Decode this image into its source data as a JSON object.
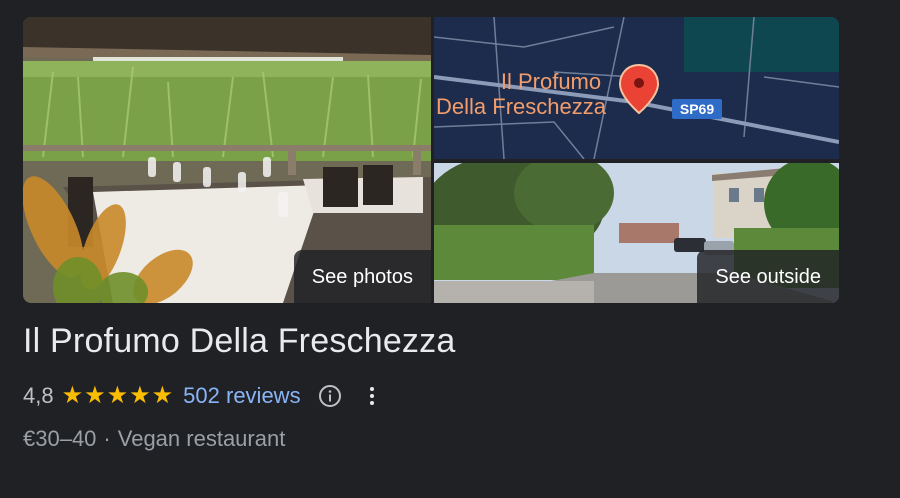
{
  "gallery": {
    "photos_label": "See photos",
    "outside_label": "See outside",
    "map": {
      "place_label_line1": "Il Profumo",
      "place_label_line2": "Della Freschezza",
      "road_label": "SP69"
    }
  },
  "place": {
    "name": "Il Profumo Della Freschezza",
    "rating": "4,8",
    "star_count": 5,
    "reviews_label": "502 reviews",
    "price": "€30–40",
    "separator": "·",
    "category": "Vegan restaurant"
  },
  "colors": {
    "background": "#202124",
    "star": "#fbbc04",
    "link": "#8ab4f8",
    "map_bg": "#1d2c4d",
    "pin": "#ea4335"
  },
  "icons": [
    "info-icon",
    "more-vert-icon",
    "star-icon",
    "map-pin-icon"
  ]
}
